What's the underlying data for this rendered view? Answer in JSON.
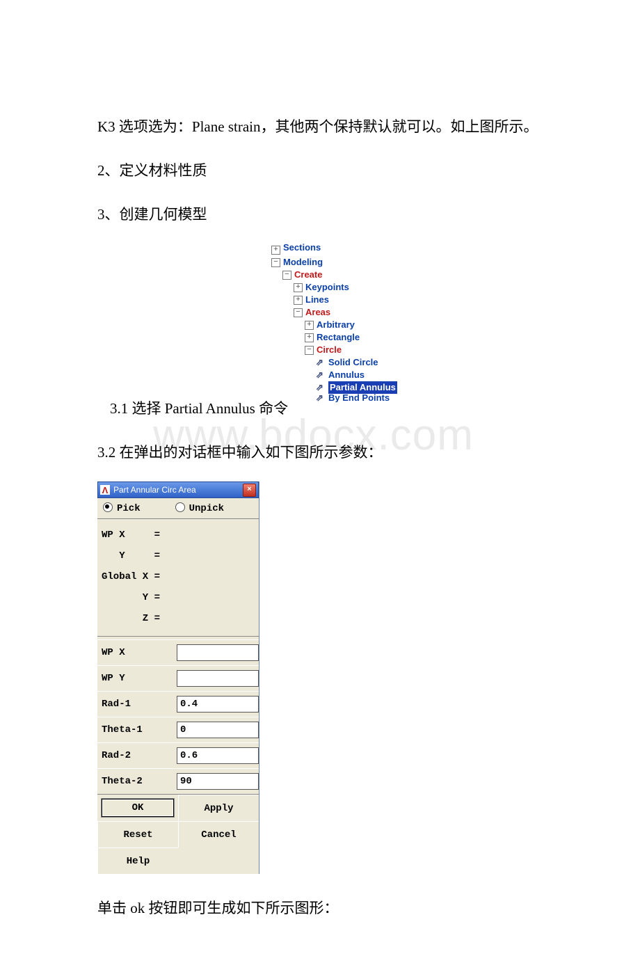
{
  "watermark": "www.bdocx.com",
  "paras": {
    "p1": "K3 选项选为：Plane strain，其他两个保持默认就可以。如上图所示。",
    "p2": "2、定义材料性质",
    "p3": "3、创建几何模型",
    "p4": "3.1 选择 Partial Annulus 命令",
    "p5": "3.2 在弹出的对话框中输入如下图所示参数：",
    "p6": "单击 ok 按钮即可生成如下所示图形："
  },
  "tree": {
    "sections": "Sections",
    "modeling": "Modeling",
    "create": "Create",
    "keypoints": "Keypoints",
    "lines": "Lines",
    "areas": "Areas",
    "arbitrary": "Arbitrary",
    "rectangle": "Rectangle",
    "circle": "Circle",
    "solid": "Solid Circle",
    "annulus": "Annulus",
    "partial": "Partial Annulus",
    "byend": "By End Points"
  },
  "dialog": {
    "title": "Part Annular Circ Area",
    "pick": "Pick",
    "unpick": "Unpick",
    "wpx_eq": "WP X     =",
    "wpy_eq": "   Y     =",
    "gx": "Global X =",
    "gy": "       Y =",
    "gz": "       Z =",
    "fields": {
      "wpx": "WP X",
      "wpy": "WP Y",
      "rad1": "Rad-1",
      "theta1": "Theta-1",
      "rad2": "Rad-2",
      "theta2": "Theta-2"
    },
    "values": {
      "wpx": "",
      "wpy": "",
      "rad1": "0.4",
      "theta1": "0",
      "rad2": "0.6",
      "theta2": "90"
    },
    "buttons": {
      "ok": "OK",
      "apply": "Apply",
      "reset": "Reset",
      "cancel": "Cancel",
      "help": "Help"
    }
  }
}
